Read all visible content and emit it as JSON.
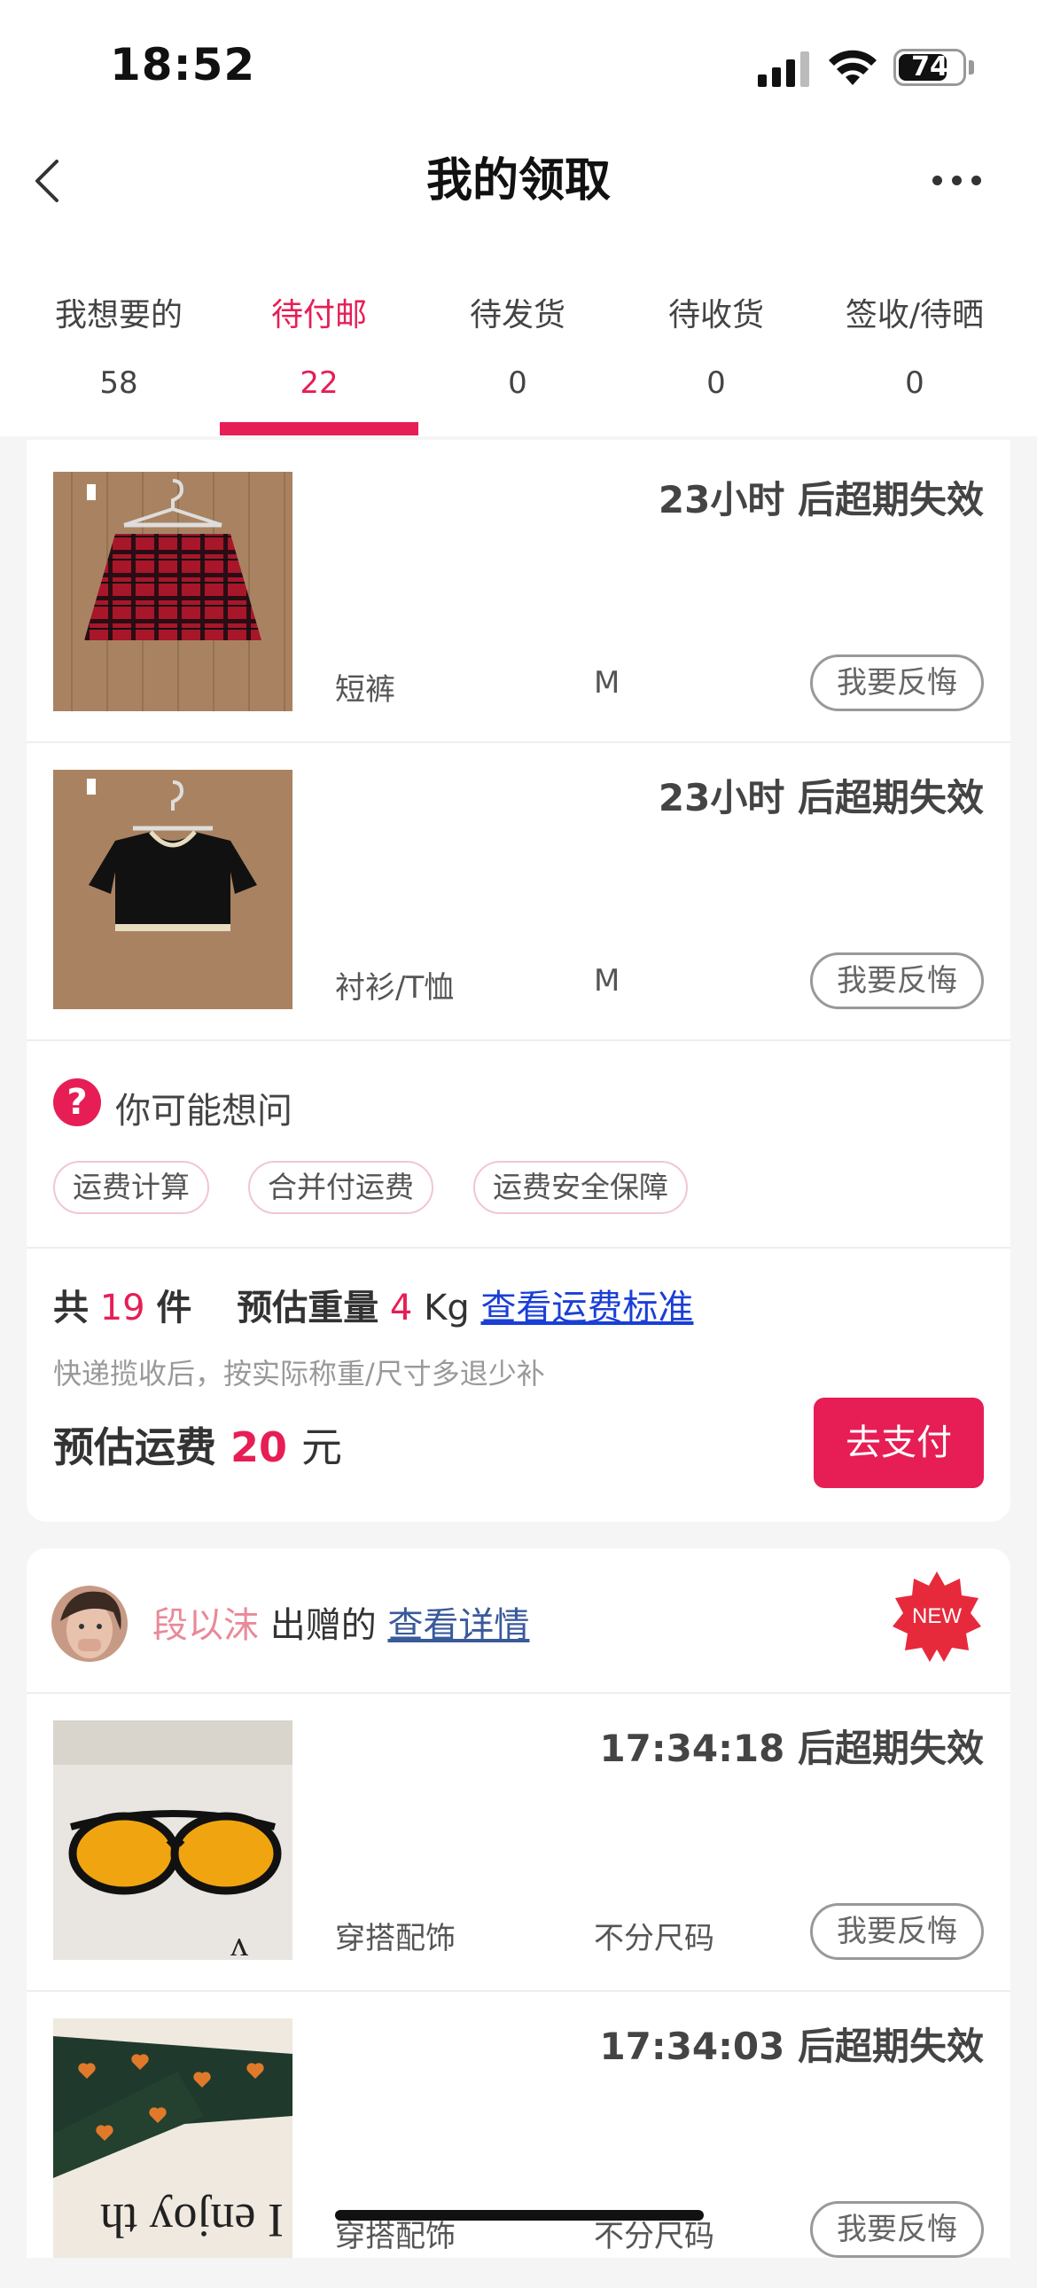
{
  "status_bar": {
    "time": "18:52",
    "battery": "74",
    "battery_level": 0.74
  },
  "header": {
    "title": "我的领取"
  },
  "tabs": [
    {
      "label": "我想要的",
      "count": "58"
    },
    {
      "label": "待付邮",
      "count": "22",
      "active": true
    },
    {
      "label": "待发货",
      "count": "0"
    },
    {
      "label": "待收货",
      "count": "0"
    },
    {
      "label": "签收/待晒",
      "count": "0"
    }
  ],
  "group1": {
    "items": [
      {
        "expire": "23小时 后超期失效",
        "category": "短裤",
        "size": "M",
        "action": "我要反悔",
        "image": "plaid-skirt"
      },
      {
        "expire": "23小时 后超期失效",
        "category": "衬衫/T恤",
        "size": "M",
        "action": "我要反悔",
        "image": "black-crop-top"
      }
    ],
    "faq": {
      "title": "你可能想问",
      "chips": [
        "运费计算",
        "合并付运费",
        "运费安全保障"
      ]
    },
    "summary": {
      "prefix": "共",
      "count": "19",
      "unit": "件",
      "weight_label": "预估重量",
      "weight": "4",
      "weight_unit": "Kg",
      "link": "查看运费标准",
      "hint": "快递揽收后，按实际称重/尺寸多退少补",
      "fee_label": "预估运费",
      "fee": "20",
      "fee_unit": "元",
      "pay_button": "去支付"
    }
  },
  "group2": {
    "giver_name": "段以沫",
    "giver_suffix": "出赠的",
    "detail_link": "查看详情",
    "badge": "NEW",
    "items": [
      {
        "expire": "17:34:18 后超期失效",
        "category": "穿搭配饰",
        "size": "不分尺码",
        "action": "我要反悔",
        "image": "yellow-sunglasses"
      },
      {
        "expire": "17:34:03 后超期失效",
        "category": "穿搭配饰",
        "size": "不分尺码",
        "action": "我要反悔",
        "image": "heart-scarf"
      }
    ]
  },
  "colors": {
    "accent": "#e61e55",
    "link": "#1a3fd6"
  }
}
